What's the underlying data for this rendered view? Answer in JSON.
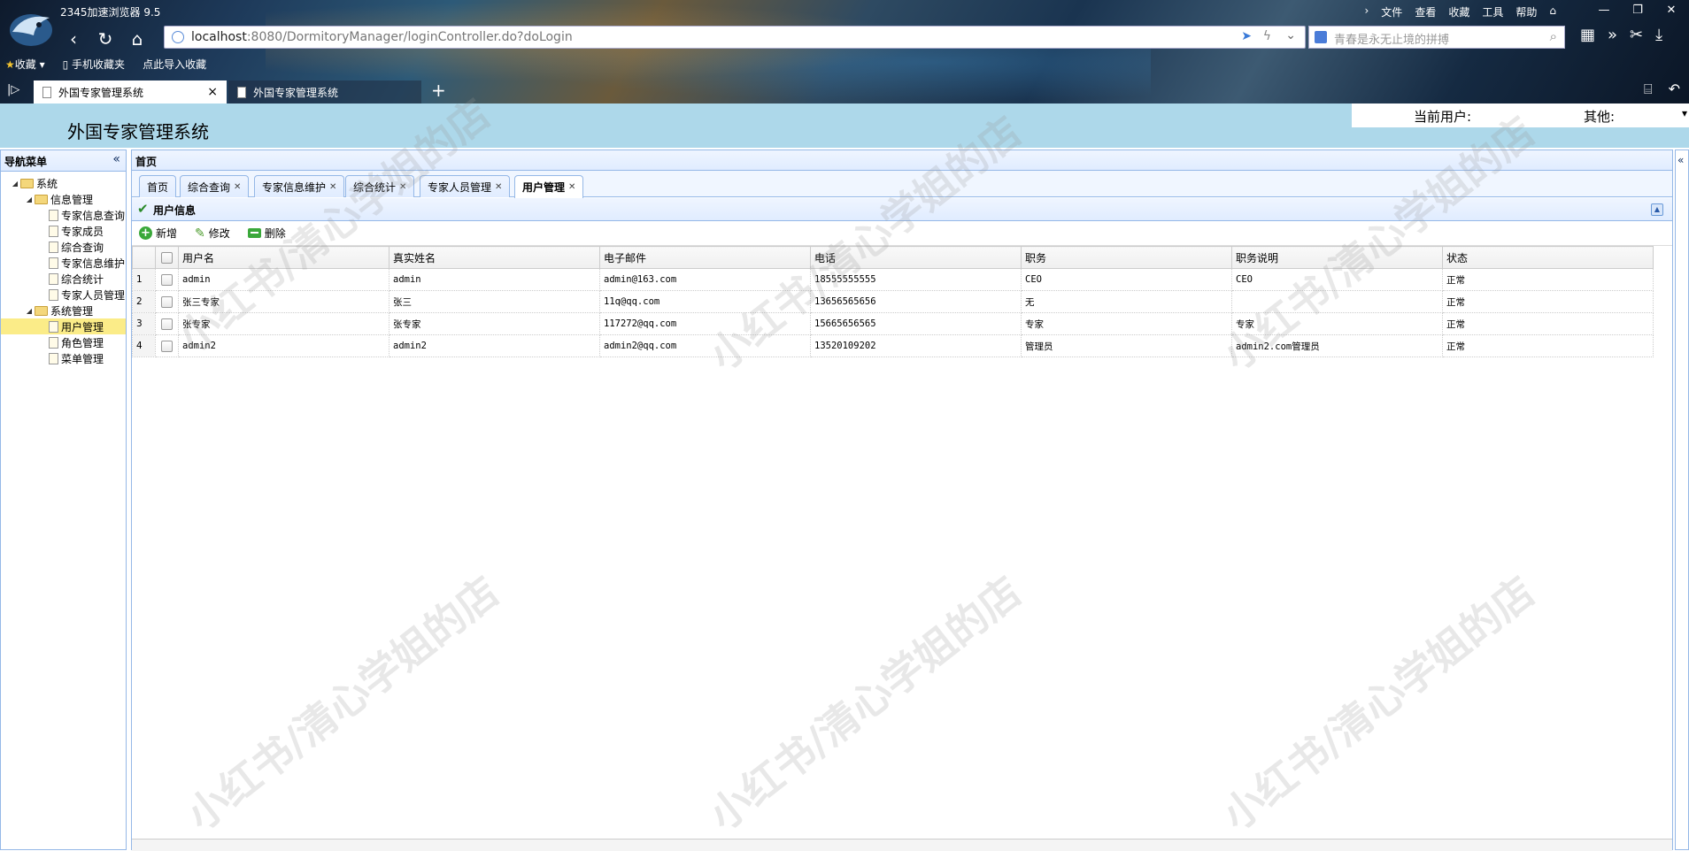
{
  "browser": {
    "title": "2345加速浏览器 9.5",
    "menu": [
      "文件",
      "查看",
      "收藏",
      "工具",
      "帮助"
    ],
    "url_host": "localhost",
    "url_rest": ":8080/DormitoryManager/loginController.do?doLogin",
    "search_placeholder": "青春是永无止境的拼搏",
    "bookmarks": [
      "收藏",
      "手机收藏夹",
      "点此导入收藏"
    ],
    "tabs": [
      "外国专家管理系统",
      "外国专家管理系统"
    ]
  },
  "app": {
    "title": "外国专家管理系统",
    "current_user_label": "当前用户:",
    "other_label": "其他:"
  },
  "nav": {
    "title": "导航菜单",
    "tree": [
      {
        "label": "系统",
        "level": 0,
        "type": "folder"
      },
      {
        "label": "信息管理",
        "level": 1,
        "type": "folder"
      },
      {
        "label": "专家信息查询",
        "level": 2,
        "type": "file"
      },
      {
        "label": "专家成员",
        "level": 2,
        "type": "file"
      },
      {
        "label": "综合查询",
        "level": 2,
        "type": "file"
      },
      {
        "label": "专家信息维护",
        "level": 2,
        "type": "file"
      },
      {
        "label": "综合统计",
        "level": 2,
        "type": "file"
      },
      {
        "label": "专家人员管理",
        "level": 2,
        "type": "file"
      },
      {
        "label": "系统管理",
        "level": 1,
        "type": "folder"
      },
      {
        "label": "用户管理",
        "level": 2,
        "type": "file",
        "selected": true
      },
      {
        "label": "角色管理",
        "level": 2,
        "type": "file"
      },
      {
        "label": "菜单管理",
        "level": 2,
        "type": "file"
      }
    ]
  },
  "main": {
    "title": "首页",
    "tabs": [
      {
        "label": "首页",
        "closable": false
      },
      {
        "label": "综合查询",
        "closable": true
      },
      {
        "label": "专家信息维护",
        "closable": true
      },
      {
        "label": "综合统计",
        "closable": true
      },
      {
        "label": "专家人员管理",
        "closable": true
      },
      {
        "label": "用户管理",
        "closable": true,
        "active": true
      }
    ],
    "panel_title": "用户信息",
    "toolbar": {
      "add": "新增",
      "edit": "修改",
      "delete": "删除"
    },
    "columns": [
      "用户名",
      "真实姓名",
      "电子邮件",
      "电话",
      "职务",
      "职务说明",
      "状态"
    ],
    "rows": [
      [
        "admin",
        "admin",
        "admin@163.com",
        "18555555555",
        "CEO",
        "CEO",
        "正常"
      ],
      [
        "张三专家",
        "张三",
        "11q@qq.com",
        "13656565656",
        "无",
        "",
        "正常"
      ],
      [
        "张专家",
        "张专家",
        "117272@qq.com",
        "15665656565",
        "专家",
        "专家",
        "正常"
      ],
      [
        "admin2",
        "admin2",
        "admin2@qq.com",
        "13520109202",
        "管理员",
        "admin2.com管理员",
        "正常"
      ]
    ]
  },
  "watermark": "小红书/清心学姐的店"
}
